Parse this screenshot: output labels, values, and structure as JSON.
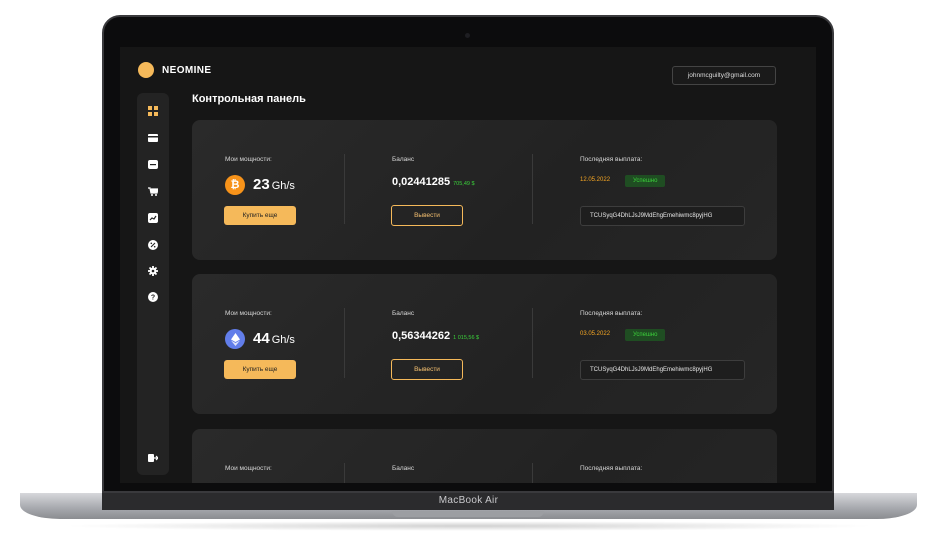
{
  "device": {
    "model_label": "MacBook Air"
  },
  "brand": {
    "name": "NEOMINE",
    "accent": "#f5b95a"
  },
  "header": {
    "email": "johnmcguilty@gmail.com"
  },
  "sidebar": {
    "items": [
      {
        "icon": "dashboard-icon"
      },
      {
        "icon": "card-icon"
      },
      {
        "icon": "wallet-icon"
      },
      {
        "icon": "cart-icon"
      },
      {
        "icon": "chart-icon"
      },
      {
        "icon": "percent-icon"
      },
      {
        "icon": "gear-icon"
      },
      {
        "icon": "help-icon"
      },
      {
        "icon": "logout-icon"
      }
    ]
  },
  "page": {
    "title": "Контрольная панель"
  },
  "cards": [
    {
      "coin_icon": "bitcoin-icon",
      "coin_color": "#f7931a",
      "power_label": "Мои мощности:",
      "power_value": "23",
      "power_unit": "Gh/s",
      "buy_label": "Купить еще",
      "balance_label": "Баланс",
      "balance_value": "0,02441285",
      "balance_usd": "705,49 $",
      "withdraw_label": "Вывести",
      "payout_label": "Последняя выплата:",
      "payout_date": "12.05.2022",
      "payout_status": "Успешно",
      "tx_id": "TCUSyqG4DhLJsJ9MdEhgEmehiwmc8pyjHG"
    },
    {
      "coin_icon": "ethereum-icon",
      "coin_color": "#627eea",
      "power_label": "Мои мощности:",
      "power_value": "44",
      "power_unit": "Gh/s",
      "buy_label": "Купить еще",
      "balance_label": "Баланс",
      "balance_value": "0,56344262",
      "balance_usd": "1 015,56 $",
      "withdraw_label": "Вывести",
      "payout_label": "Последняя выплата:",
      "payout_date": "03.05.2022",
      "payout_status": "Успешно",
      "tx_id": "TCUSyqG4DhLJsJ9MdEhgEmehiwmc8pyjHG"
    },
    {
      "power_label": "Мои мощности:",
      "balance_label": "Баланс",
      "payout_label": "Последняя выплата:"
    }
  ]
}
